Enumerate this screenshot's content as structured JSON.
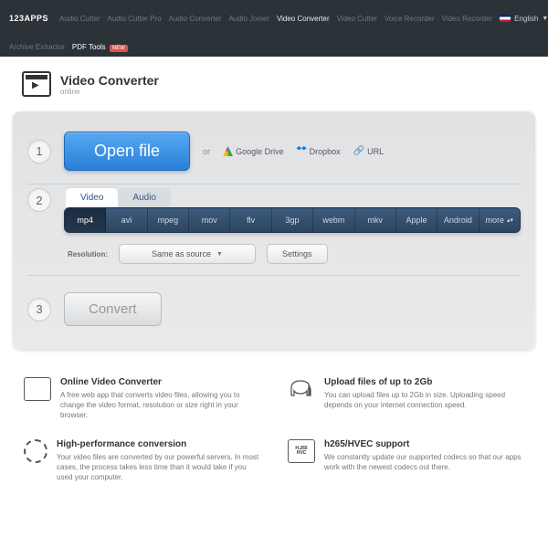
{
  "nav": {
    "brand": "123APPS",
    "links": [
      "Audio Cutter",
      "Audio Cutter Pro",
      "Audio Converter",
      "Audio Joiner",
      "Video Converter",
      "Video Cutter",
      "Voice Recorder",
      "Video Recorder",
      "Archive Extractor"
    ],
    "pdf": "PDF Tools",
    "new": "NEW",
    "active_index": 4,
    "lang": "English"
  },
  "header": {
    "title": "Video Converter",
    "subtitle": "online"
  },
  "step1": {
    "open": "Open file",
    "or": "or",
    "gdrive": "Google Drive",
    "dropbox": "Dropbox",
    "url": "URL"
  },
  "step2": {
    "tabs": [
      "Video",
      "Audio"
    ],
    "active_tab": 0,
    "formats": [
      "mp4",
      "avi",
      "mpeg",
      "mov",
      "flv",
      "3gp",
      "webm",
      "mkv",
      "Apple",
      "Android",
      "more"
    ],
    "active_format": 0,
    "res_label": "Resolution:",
    "res_value": "Same as source",
    "settings": "Settings"
  },
  "step3": {
    "convert": "Convert"
  },
  "features": [
    {
      "title": "Online Video Converter",
      "body": "A free web app that converts video files, allowing you to change the video format, resolution or size right in your browser."
    },
    {
      "title": "Upload files of up to 2Gb",
      "body": "You can upload files up to 2Gb in size. Uploading speed depends on your internet connection speed."
    },
    {
      "title": "High-performance conversion",
      "body": "Your video files are converted by our powerful servers. In most cases, the process takes less time than it would take if you used your computer."
    },
    {
      "title": "h265/HVEC support",
      "body": "We constantly update our supported codecs so that our apps work with the newest codecs out there."
    }
  ]
}
